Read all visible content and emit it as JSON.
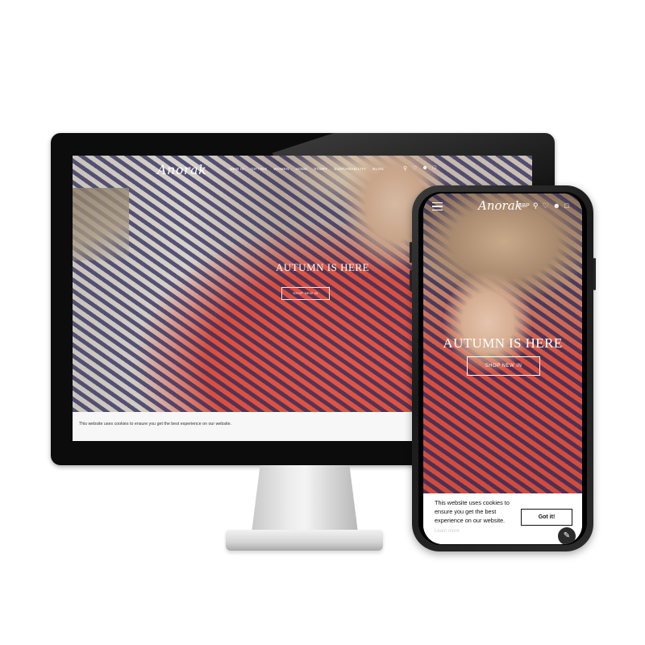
{
  "desktop": {
    "logo": "Anorak",
    "nav_links": [
      "NEW IN",
      "GIFTING",
      "WOMEN",
      "HOME",
      "STORY",
      "SUSTAINABILITY",
      "BLOG"
    ],
    "nav_icons": [
      "search-icon",
      "heart-icon",
      "user-icon",
      "bag-icon"
    ],
    "hero": {
      "headline": "AUTUMN IS HERE",
      "cta_label": "SHOP NEW IN"
    },
    "cookie_text": "This website uses cookies to ensure you get the best experience on our website."
  },
  "mobile": {
    "logo": "Anorak",
    "currency": "GBP",
    "nav_icons": [
      "search-icon",
      "heart-icon",
      "user-icon",
      "bag-icon"
    ],
    "hero": {
      "headline": "AUTUMN IS HERE",
      "cta_label": "SHOP NEW IN"
    },
    "cookie": {
      "text": "This website uses cookies to ensure you get the best experience on our website.",
      "button_label": "Got it!",
      "more_link": "Learn more"
    }
  }
}
